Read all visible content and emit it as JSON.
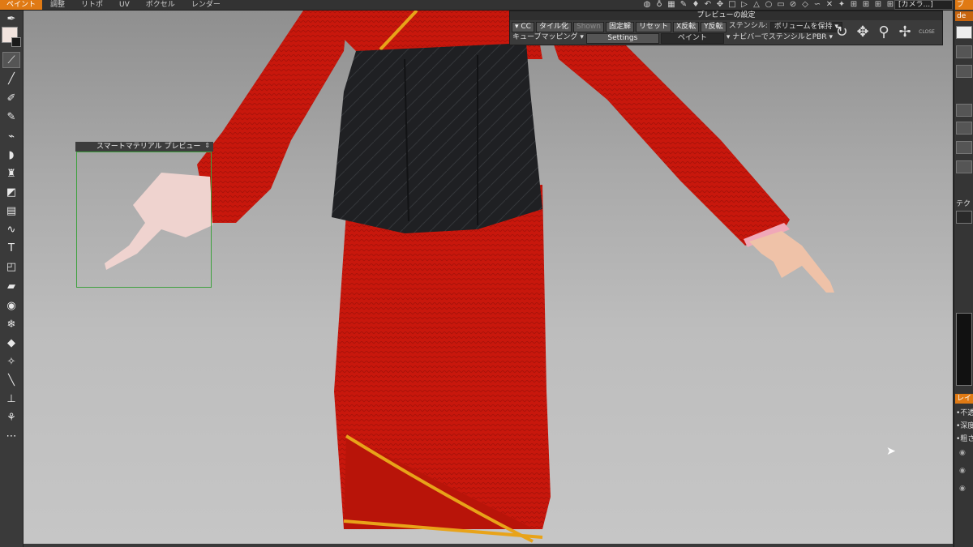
{
  "menubar": {
    "items": [
      "ペイント",
      "調整",
      "リトポ",
      "UV",
      "ボクセル",
      "レンダー"
    ],
    "active_index": 0,
    "camera_select": "[カメラ...]"
  },
  "preview_panel": {
    "title": "プレビューの設定",
    "row1": {
      "cc": "CC",
      "tile": "タイル化",
      "shown": "Shown",
      "fixed": "固定解",
      "reset": "リセット",
      "x_flip": "X反転",
      "y_flip": "Y反転",
      "stencil_label": "ステンシル:",
      "stencil_value": "ボリュームを保持"
    },
    "row2": {
      "cube_mapping": "キューブマッピング",
      "settings": "Settings",
      "paint": "ペイント",
      "navi": "ナビバーでステンシルとPBR"
    },
    "close_label": "CLOSE"
  },
  "smart_material_preview": {
    "title": "スマートマテリアル プレビュー"
  },
  "right_panel": {
    "tab_top": "ブ",
    "tab_top2": "de",
    "label_tex": "テク",
    "tab_layer": "レイ",
    "items": [
      "•不透",
      "•深度",
      "•粗さ"
    ]
  },
  "colors": {
    "accent": "#e07a14",
    "robe_red": "#cc1a0e",
    "obi_black": "#1e1f22",
    "trim_gold": "#e8a319",
    "skin": "#efc8b8",
    "preview_frame": "#3fa13f"
  }
}
